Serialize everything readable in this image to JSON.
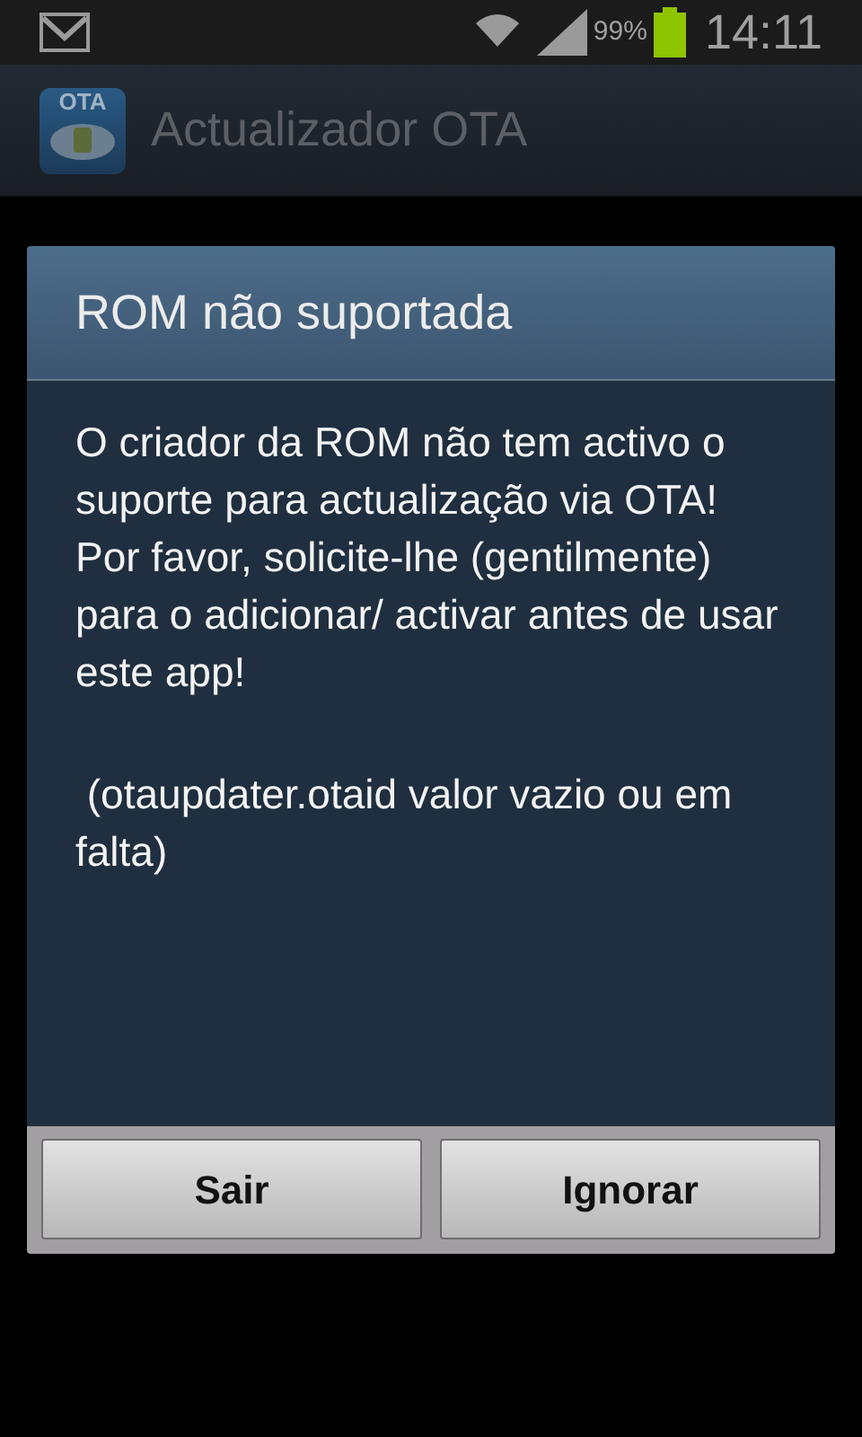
{
  "status_bar": {
    "battery": "99%",
    "time": "14:11"
  },
  "app_bar": {
    "icon_label": "OTA",
    "title": "Actualizador OTA"
  },
  "dialog": {
    "title": "ROM não suportada",
    "paragraphs": [
      "O criador da ROM não tem activo o suporte para actualização via OTA! Por favor, solicite-lhe (gentilmente) para o adicionar/ activar antes de usar este app!",
      " (otaupdater.otaid valor vazio ou em falta)"
    ],
    "buttons": [
      "Sair",
      "Ignorar"
    ]
  }
}
